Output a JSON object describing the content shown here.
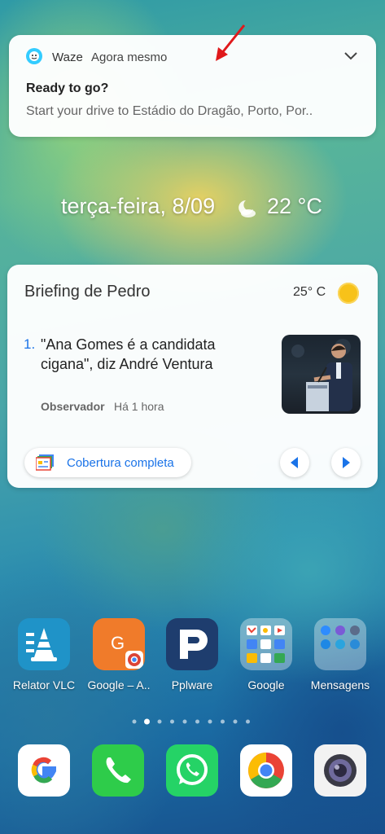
{
  "notification": {
    "app_name": "Waze",
    "time": "Agora mesmo",
    "title": "Ready to go?",
    "body": "Start your drive to Estádio do Dragão, Porto, Por.."
  },
  "lockscreen": {
    "date": "terça-feira, 8/09",
    "temperature": "22 °C"
  },
  "briefing": {
    "title": "Briefing de Pedro",
    "temperature": "25° C",
    "item_number": "1.",
    "headline": "\"Ana Gomes é a candidata cigana\", diz André Ventura",
    "source": "Observador",
    "time_ago": "Há 1 hora",
    "full_coverage_label": "Cobertura completa"
  },
  "apps": [
    {
      "label": "Relator VLC",
      "icon": "vlc-reporter-icon"
    },
    {
      "label": "Google – A..",
      "icon": "google-ads-icon"
    },
    {
      "label": "Pplware",
      "icon": "pplware-icon"
    },
    {
      "label": "Google",
      "icon": "google-folder-icon"
    },
    {
      "label": "Mensagens",
      "icon": "messages-folder-icon"
    }
  ],
  "pager": {
    "current_page": 2,
    "total_pages": 10
  },
  "dock": [
    {
      "icon": "google-search-icon"
    },
    {
      "icon": "phone-icon"
    },
    {
      "icon": "whatsapp-icon"
    },
    {
      "icon": "chrome-icon"
    },
    {
      "icon": "camera-icon"
    }
  ],
  "colors": {
    "accent": "#1a73e8",
    "arrow": "#e0191b",
    "waze": "#33ccff"
  }
}
